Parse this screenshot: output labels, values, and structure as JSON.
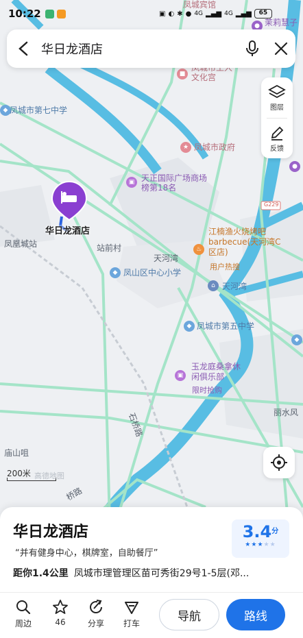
{
  "status_bar": {
    "time": "10:22",
    "signal_1": "4G",
    "signal_2": "4G",
    "battery": "65"
  },
  "search": {
    "query": "华日龙酒店"
  },
  "tools": {
    "layers_label": "图层",
    "feedback_label": "反馈"
  },
  "map": {
    "scale_label": "200米",
    "watermark": "高德地图",
    "hotel_marker_label": "华日龙酒店",
    "labels": {
      "fengcheng_guesthouse": "凤城宾馆",
      "jasmine": "茉莉慧子",
      "people_culture_hall": "凤城市工人文化宫",
      "middle_school_7": "凤城市第七中学",
      "city_government": "凤城市政府",
      "tianzheng_plaza": "天正国际广场商场榜第18名",
      "g229": "G229",
      "bbq": "江楠渔火烧烤吧barbecue(天河湾C区店)",
      "bbq_hot": "用户热搜",
      "fenghuang_station": "凤凰城站",
      "zhanqian_village": "站前村",
      "tianhe_bay_1": "天河湾",
      "fengshan_school": "凤山区中心小学",
      "tianhe_bay_2": "天河湾",
      "middle_school_5": "凤城市第五中学",
      "yulong_club": "玉龙庭桑拿休闲俱乐部",
      "yulong_promo": "限时抢购",
      "shiqiao_road": "石桥路",
      "lishui": "丽水风",
      "miaoshan": "庙山咀",
      "qiao_road": "桥路"
    }
  },
  "hotel": {
    "name": "华日龙酒店",
    "features": "“并有健身中心，棋牌室，自助餐厅”",
    "distance": "距你1.4公里",
    "address": "凤城市理管理区苗可秀街29号1-5层(邓...",
    "rating": "3.4",
    "rating_unit": "分",
    "stars": 3.5
  },
  "actions": {
    "nearby": "周边",
    "favorite": "46",
    "share": "分享",
    "taxi": "打车",
    "navigate": "导航",
    "route": "路线"
  },
  "colors": {
    "accent": "#1f73e8",
    "river": "#4cb8e0",
    "road": "#9fe2c7",
    "hotel_pin": "#8a3fd1"
  }
}
